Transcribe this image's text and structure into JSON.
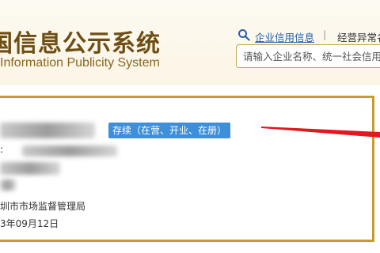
{
  "header": {
    "title": "国信息公示系统",
    "subtitle": "Information Publicity System",
    "links": {
      "credit_info": "企业信用信息",
      "separator": "|",
      "abnormal_list": "经营异常名录"
    }
  },
  "search": {
    "placeholder": "请输入企业名称、统一社会信用代码或注册号"
  },
  "result": {
    "status": "存续（在营、开业、在册）",
    "legal_rep_label": ":",
    "authority": "圳市市场监督管理局",
    "registration_date": "3年09月12日"
  },
  "colors": {
    "title_brown": "#6e4e14",
    "card_border": "#c99a32",
    "badge_blue": "#3d8fd9",
    "link_blue": "#1f5fa6",
    "arrow_red": "#e0191e"
  }
}
